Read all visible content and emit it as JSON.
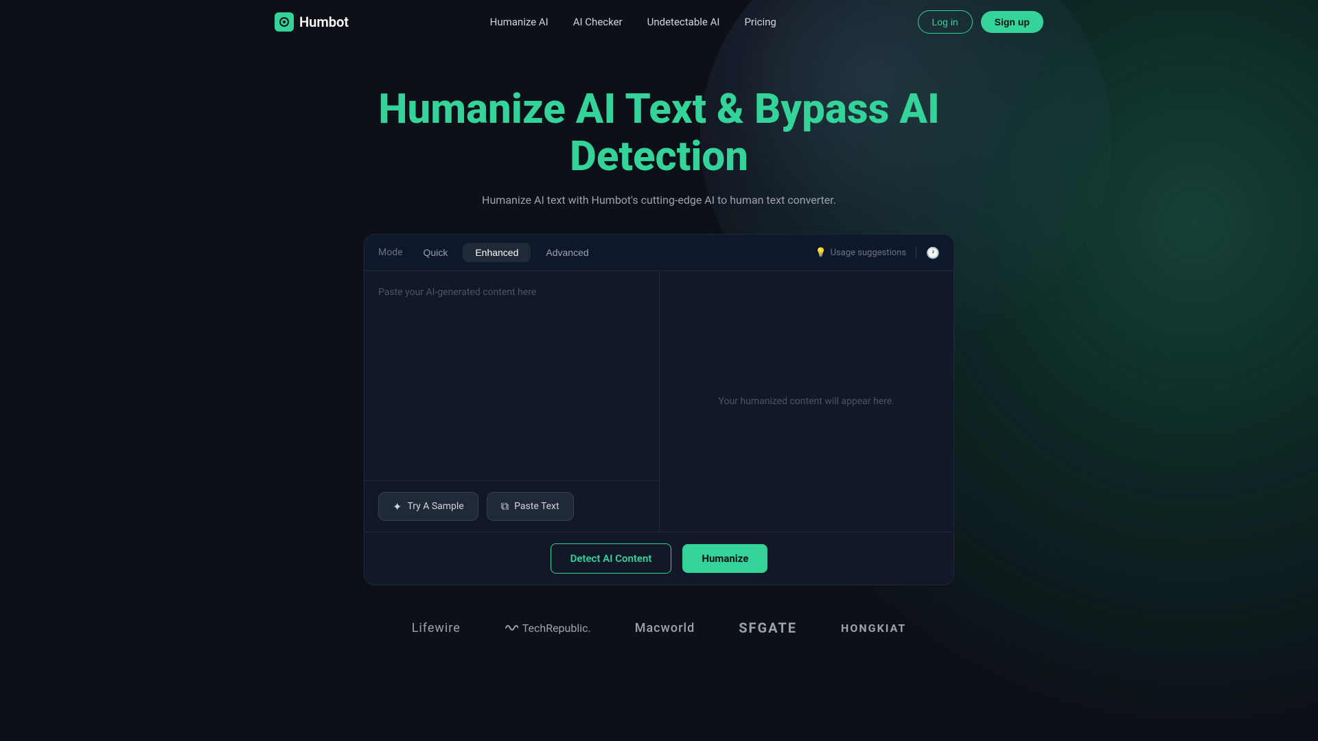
{
  "nav": {
    "logo_icon": "H",
    "logo_text": "Humbot",
    "links": [
      {
        "label": "Humanize AI",
        "id": "humanize-ai"
      },
      {
        "label": "AI Checker",
        "id": "ai-checker"
      },
      {
        "label": "Undetectable AI",
        "id": "undetectable-ai"
      },
      {
        "label": "Pricing",
        "id": "pricing"
      }
    ],
    "login_label": "Log in",
    "signup_label": "Sign up"
  },
  "hero": {
    "title": "Humanize AI Text & Bypass AI Detection",
    "subtitle": "Humanize AI text with Humbot's cutting-edge AI to human text converter."
  },
  "editor": {
    "mode_label": "Mode",
    "tabs": [
      {
        "label": "Quick",
        "id": "quick",
        "active": false
      },
      {
        "label": "Enhanced",
        "id": "enhanced",
        "active": true
      },
      {
        "label": "Advanced",
        "id": "advanced",
        "active": false
      }
    ],
    "usage_suggestions": "Usage suggestions",
    "input_placeholder": "Paste your AI-generated content here",
    "output_placeholder": "Your humanized content will appear here.",
    "try_sample_label": "Try A Sample",
    "paste_text_label": "Paste Text",
    "detect_btn": "Detect AI Content",
    "humanize_btn": "Humanize"
  },
  "brands": [
    {
      "label": "Lifewire",
      "class": "lifewire"
    },
    {
      "label": "TechRepublic.",
      "class": "techrepublic"
    },
    {
      "label": "Macworld",
      "class": "macworld"
    },
    {
      "label": "SFGATE",
      "class": "sfgate"
    },
    {
      "label": "HONGKIAT",
      "class": "hongkiat"
    }
  ]
}
